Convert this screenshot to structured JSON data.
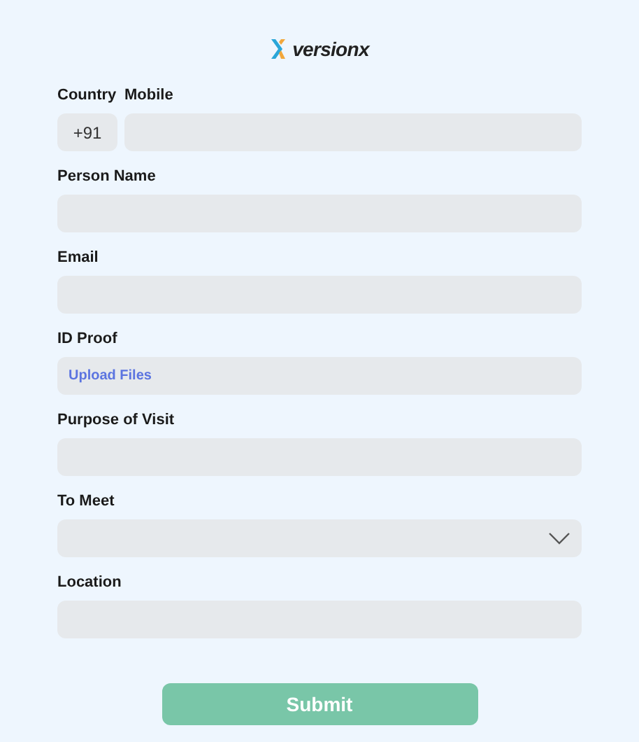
{
  "logo": {
    "text": "versionx"
  },
  "phone": {
    "country_label": "Country",
    "country_code": "+91",
    "mobile_label": "Mobile"
  },
  "fields": [
    {
      "kind": "text",
      "label": "Person Name"
    },
    {
      "kind": "text",
      "label": "Email"
    },
    {
      "kind": "upload",
      "label": "ID Proof",
      "action": "Upload Files"
    },
    {
      "kind": "text",
      "label": "Purpose of Visit"
    },
    {
      "kind": "select",
      "label": "To Meet"
    },
    {
      "kind": "text",
      "label": "Location"
    }
  ],
  "submit": {
    "label": "Submit"
  }
}
